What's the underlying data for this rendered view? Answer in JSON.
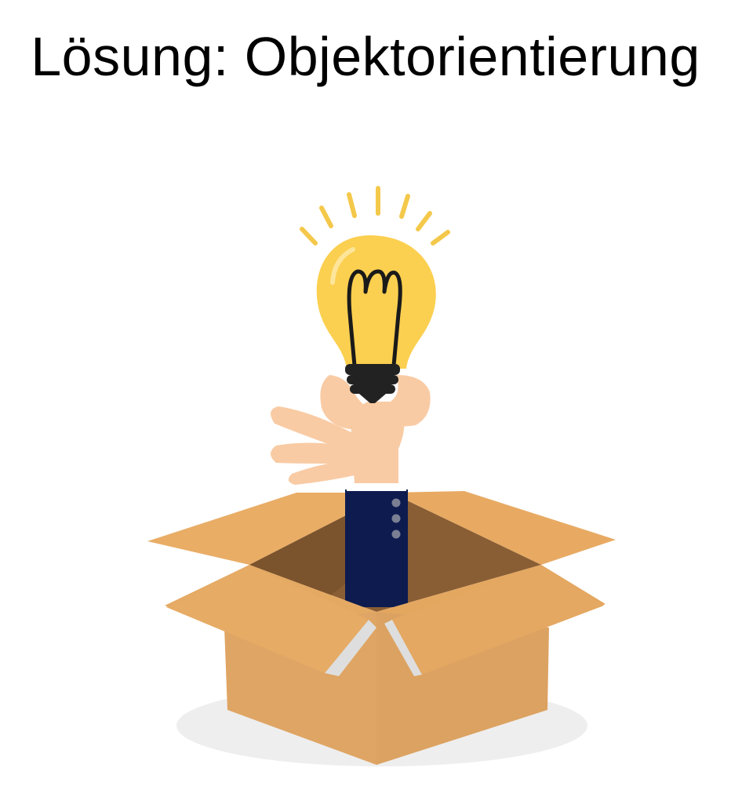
{
  "slide": {
    "title": "Lösung: Objektorientierung"
  },
  "illustration": {
    "icon": "idea-lightbulb-out-of-box-icon",
    "colors": {
      "bulb_glass": "#fbcf4f",
      "bulb_rays": "#f4c84a",
      "bulb_base": "#222222",
      "hand_skin": "#f9cba4",
      "sleeve": "#0d1b4f",
      "sleeve_buttons": "#7a7f93",
      "box_front": "#dfa564",
      "box_flap": "#e9ad66",
      "box_inside": "#8a5e34",
      "box_edge_light": "#dedede",
      "shadow": "#eeeeee"
    }
  }
}
